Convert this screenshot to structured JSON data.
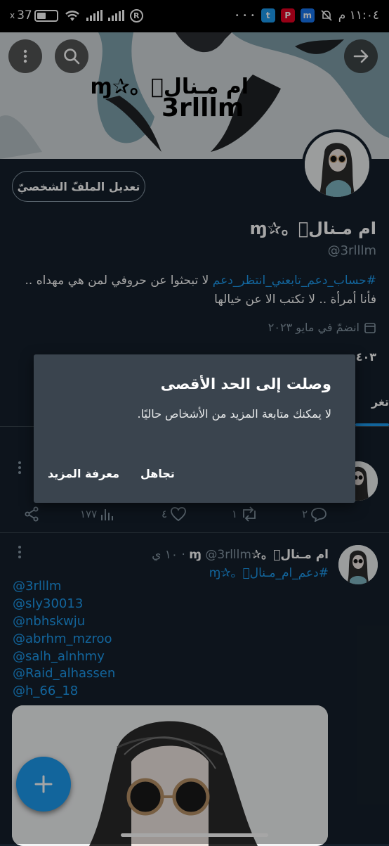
{
  "status_bar": {
    "time": "١١:٠٤ م",
    "battery": "37",
    "overflow": "• • •"
  },
  "header": {
    "banner_title": "ام مـنال᪲。✰ɱ",
    "banner_handle": "3rlllm"
  },
  "profile": {
    "edit_button": "تعديل الملفّ الشخصيّ",
    "display_name": "ام مـنال᪲。✰ɱ",
    "handle": "@3rlllm",
    "bio_tags": "#حساب_دعم_تابعني_انتظر_دعم",
    "bio_text": " لا تبحثوا عن حروفي لمن هي مهداه .. فأنا أمرأة .. لا تكتب الا عن خيالها",
    "joined": "انضمّ في مايو ٢٠٢٣",
    "follow_count": "٤٠٣",
    "tab_peek": "تغر"
  },
  "tweet1": {
    "replies": "٢",
    "retweets": "١",
    "likes": "٤",
    "views": "١٧٧"
  },
  "tweet2": {
    "name": "ام مـنال᪲。✰ɱ",
    "handle": "@3rlllm",
    "time": "١٠ ي",
    "hashtag": "#دعم_ام_مـنال᪲。✰ɱ",
    "mentions": [
      "@3rlllm",
      "@sly30013",
      "@nbhskwju",
      "@abrhm_mzroo",
      "@salh_alnhmy",
      "@Raid_alhassen",
      "@h_66_18"
    ]
  },
  "dialog": {
    "title": "وصلت إلى الحد الأقصى",
    "message": "لا يمكنك متابعة المزيد من الأشخاص حاليًا.",
    "ignore_button": "تجاهل",
    "learn_more_button": "معرفة المزيد"
  },
  "colors": {
    "background": "#15202b",
    "accent": "#1d9bf0",
    "muted": "#8899a6",
    "dialog": "#3a444e"
  }
}
